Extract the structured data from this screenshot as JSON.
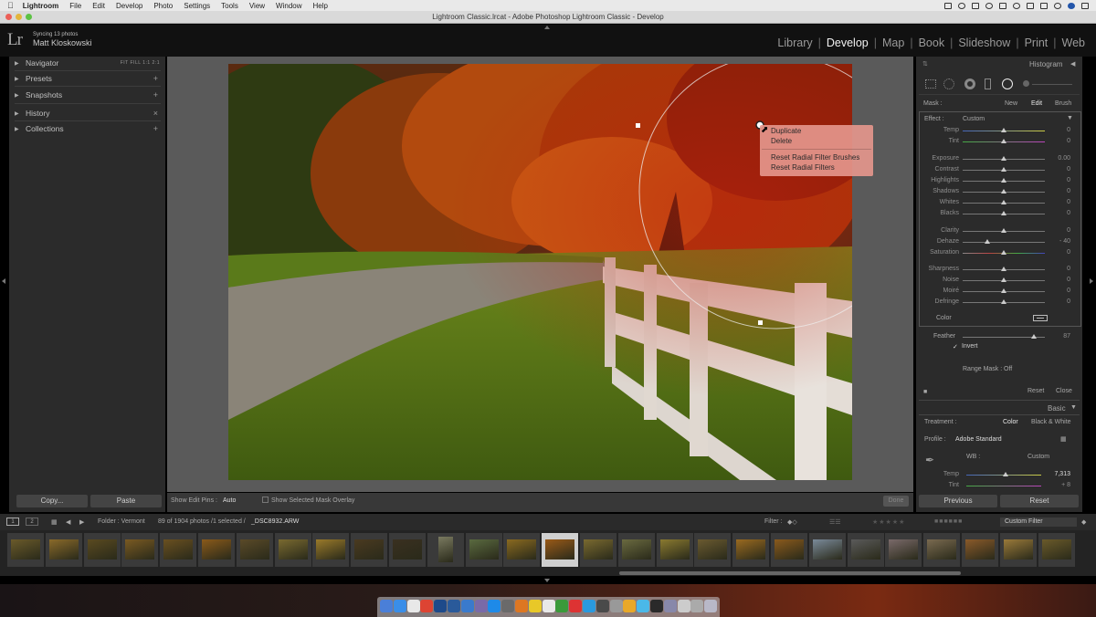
{
  "menubar": {
    "app_name": "Lightroom",
    "items": [
      "File",
      "Edit",
      "Develop",
      "Photo",
      "Settings",
      "Tools",
      "View",
      "Window",
      "Help"
    ]
  },
  "window": {
    "title": "Lightroom Classic.lrcat - Adobe Photoshop Lightroom Classic - Develop"
  },
  "identity": {
    "logo": "Lr",
    "sync_status": "Syncing 13 photos",
    "user_name": "Matt Kloskowski"
  },
  "modules": [
    "Library",
    "Develop",
    "Map",
    "Book",
    "Slideshow",
    "Print",
    "Web"
  ],
  "active_module": "Develop",
  "left_panel": {
    "sections": [
      "Navigator",
      "Presets",
      "Snapshots",
      "History",
      "Collections"
    ],
    "navigator_zoom": "FIT  FILL  1:1  2:1",
    "copy_label": "Copy...",
    "paste_label": "Paste"
  },
  "context_menu": {
    "items": [
      "Duplicate",
      "Delete",
      "Reset Radial Filter Brushes",
      "Reset Radial Filters"
    ]
  },
  "toolbar": {
    "show_edit_pins_label": "Show Edit Pins :",
    "show_edit_pins_value": "Auto",
    "mask_overlay_label": "Show Selected Mask Overlay",
    "done_label": "Done"
  },
  "right_panel": {
    "histogram_label": "Histogram",
    "mask_label": "Mask :",
    "mask_modes": [
      "New",
      "Edit",
      "Brush"
    ],
    "effect_label": "Effect :",
    "effect_value": "Custom",
    "sliders": [
      {
        "label": "Temp",
        "value": "0",
        "pos": 0.5
      },
      {
        "label": "Tint",
        "value": "0",
        "pos": 0.5
      },
      {
        "label": "Exposure",
        "value": "0.00",
        "pos": 0.5
      },
      {
        "label": "Contrast",
        "value": "0",
        "pos": 0.5
      },
      {
        "label": "Highlights",
        "value": "0",
        "pos": 0.5
      },
      {
        "label": "Shadows",
        "value": "0",
        "pos": 0.5
      },
      {
        "label": "Whites",
        "value": "0",
        "pos": 0.5
      },
      {
        "label": "Blacks",
        "value": "0",
        "pos": 0.5
      },
      {
        "label": "Clarity",
        "value": "0",
        "pos": 0.5
      },
      {
        "label": "Dehaze",
        "value": "- 40",
        "pos": 0.3
      },
      {
        "label": "Saturation",
        "value": "0",
        "pos": 0.5
      },
      {
        "label": "Sharpness",
        "value": "0",
        "pos": 0.5
      },
      {
        "label": "Noise",
        "value": "0",
        "pos": 0.5
      },
      {
        "label": "Moiré",
        "value": "0",
        "pos": 0.5
      },
      {
        "label": "Defringe",
        "value": "0",
        "pos": 0.5
      }
    ],
    "color_label": "Color",
    "feather_label": "Feather",
    "feather_value": "87",
    "feather_pos": 0.87,
    "invert_label": "Invert",
    "range_mask_label": "Range Mask :",
    "range_mask_value": "Off",
    "reset_label": "Reset",
    "close_label": "Close",
    "basic_label": "Basic",
    "treatment_label": "Treatment :",
    "treatment_options": [
      "Color",
      "Black & White"
    ],
    "profile_label": "Profile :",
    "profile_value": "Adobe Standard",
    "wb_label": "WB :",
    "wb_value": "Custom",
    "basic_temp_label": "Temp",
    "basic_temp_value": "7,313",
    "basic_tint_label": "Tint",
    "basic_tint_value": "+ 8",
    "previous_label": "Previous",
    "reset_button_label": "Reset"
  },
  "filmstrip_bar": {
    "folder_label": "Folder : Vermont",
    "count_text": "89 of 1904 photos /1 selected /",
    "file_name": "_DSC8932.ARW",
    "filter_label": "Filter :",
    "filter_value": "Custom Filter"
  },
  "colors": {
    "accent": "#e0e0e0",
    "panel_bg": "#2b2b2b",
    "context_menu_bg": "#e4968c"
  }
}
